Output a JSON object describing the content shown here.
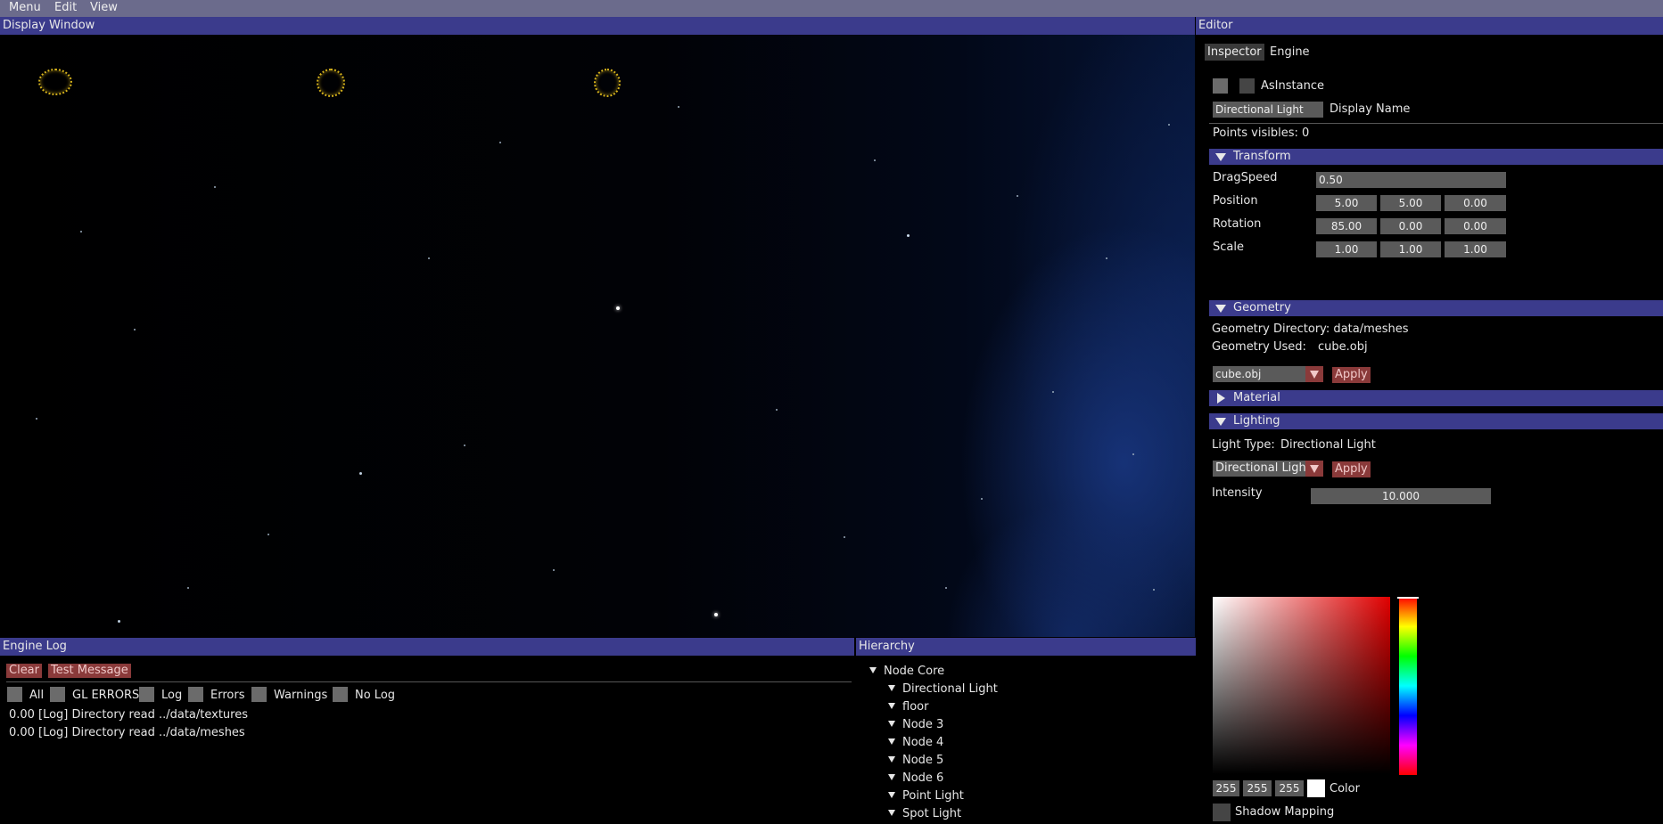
{
  "menu": [
    "Menu",
    "Edit",
    "View"
  ],
  "display_window": {
    "title": "Display Window"
  },
  "editor": {
    "title": "Editor",
    "tabs": [
      "Inspector",
      "Engine"
    ],
    "as_instance_label": "AsInstance",
    "name_value": "Directional Light",
    "display_name_label": "Display Name",
    "points_visible": "Points visibles: 0",
    "transform": {
      "title": "Transform",
      "drag_speed_label": "DragSpeed",
      "drag_speed": "0.50",
      "position_label": "Position",
      "position": [
        "5.00",
        "5.00",
        "0.00"
      ],
      "rotation_label": "Rotation",
      "rotation": [
        "85.00",
        "0.00",
        "0.00"
      ],
      "scale_label": "Scale",
      "scale": [
        "1.00",
        "1.00",
        "1.00"
      ]
    },
    "geometry": {
      "title": "Geometry",
      "directory": "Geometry Directory: data/meshes",
      "used_label": "Geometry Used:",
      "used_value": "cube.obj",
      "combo_value": "cube.obj",
      "apply": "Apply"
    },
    "material": {
      "title": "Material"
    },
    "lighting": {
      "title": "Lighting",
      "light_type_label": "Light Type:",
      "light_type_value": "Directional Light",
      "combo_value": "Directional Light",
      "apply": "Apply",
      "intensity_label": "Intensity",
      "intensity": "10.000",
      "color": [
        "255",
        "255",
        "255"
      ],
      "color_label": "Color",
      "shadow_label": "Shadow Mapping"
    }
  },
  "engine_log": {
    "title": "Engine Log",
    "clear": "Clear",
    "test_message": "Test Message",
    "filters": [
      "All",
      "GL ERRORS",
      "Log",
      "Errors",
      "Warnings",
      "No Log"
    ],
    "entries": [
      {
        "time": "0.00",
        "text": "[Log] Directory read ../data/textures"
      },
      {
        "time": "0.00",
        "text": "[Log] Directory read ../data/meshes"
      }
    ]
  },
  "hierarchy": {
    "title": "Hierarchy",
    "root": "Node Core",
    "children": [
      "Directional Light",
      "floor",
      "Node 3",
      "Node 4",
      "Node 5",
      "Node 6",
      "Point Light",
      "Spot Light"
    ]
  },
  "colors": {
    "title_bar": "#3b3b8c",
    "menu_bar": "#6b6b8c",
    "button_red": "#8a3a3a",
    "field": "#5a5a5a"
  }
}
